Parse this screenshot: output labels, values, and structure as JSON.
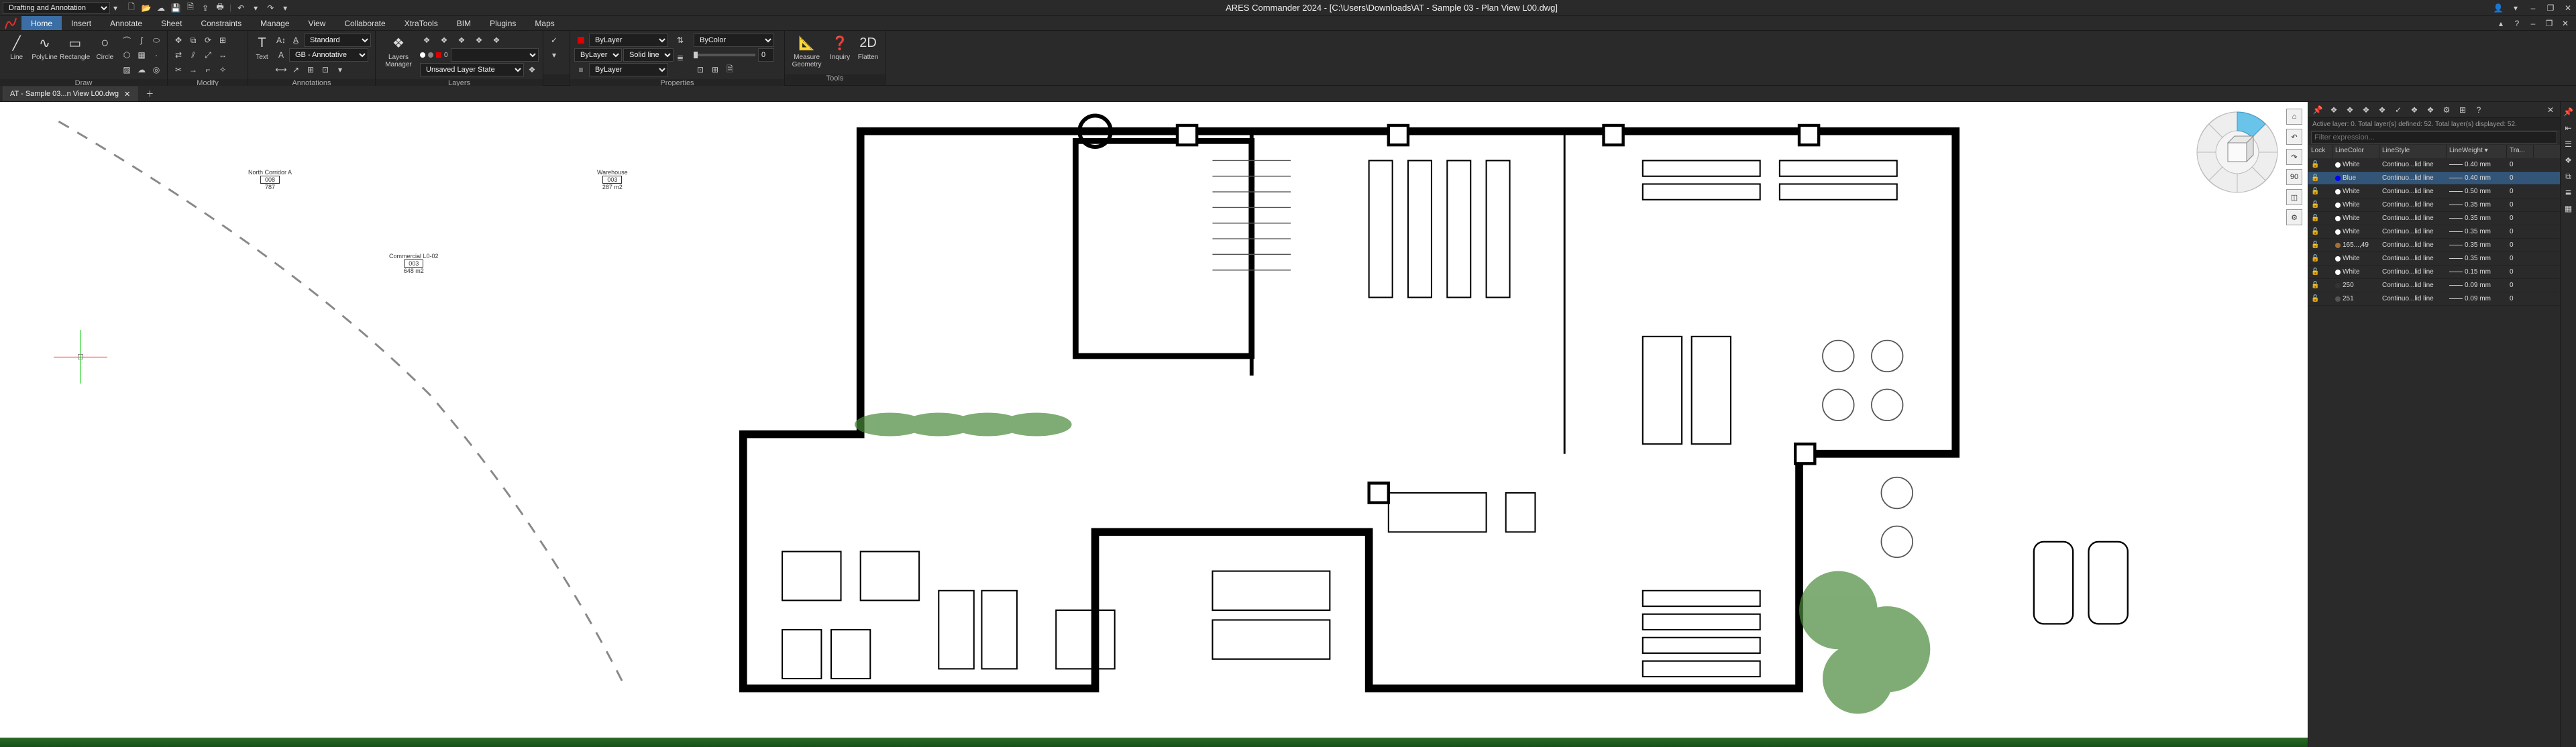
{
  "titlebar": {
    "workspace": "Drafting and Annotation",
    "app_title": "ARES Commander 2024 - [C:\\Users\\Downloads\\AT - Sample 03 - Plan View L00.dwg]"
  },
  "menu": {
    "tabs": [
      "Home",
      "Insert",
      "Annotate",
      "Sheet",
      "Constraints",
      "Manage",
      "View",
      "Collaborate",
      "XtraTools",
      "BIM",
      "Plugins",
      "Maps"
    ],
    "active": "Home"
  },
  "ribbon": {
    "draw": {
      "label": "Draw",
      "tools": [
        "Line",
        "PolyLine",
        "Rectangle",
        "Circle"
      ]
    },
    "modify": {
      "label": "Modify"
    },
    "annotations": {
      "label": "Annotations",
      "text_label": "Text",
      "style_combo": "Standard",
      "dim_combo": "GB - Annotative"
    },
    "layers": {
      "label": "Layers",
      "manager_label": "Layers Manager",
      "state_combo": "Unsaved Layer State"
    },
    "properties": {
      "label": "Properties",
      "color_combo": "ByLayer",
      "linetype1": "ByLayer",
      "linetype2": "Solid line",
      "linetype3": "ByLayer",
      "bycolor": "ByColor",
      "transparency": "0"
    },
    "tools": {
      "label": "Tools",
      "measure_label": "Measure Geometry",
      "inquiry_label": "Inquiry",
      "flatten_label": "Flatten"
    }
  },
  "doctab": {
    "name": "AT - Sample 03...n View L00.dwg"
  },
  "nav": {
    "angle": "90"
  },
  "drawing_labels": {
    "corridor": {
      "title": "North Corridor A",
      "num": "008",
      "area": "787"
    },
    "warehouse": {
      "title": "Warehouse",
      "num": "003",
      "area": "287 m2"
    },
    "commercial": {
      "title": "Commercial L0-02",
      "num": "003",
      "area": "648 m2"
    }
  },
  "layer_panel": {
    "status": "Active layer: 0. Total layer(s) defined: 52. Total layer(s) displayed: 52.",
    "filter_placeholder": "Filter expression...",
    "headers": {
      "lock": "Lock",
      "color": "LineColor",
      "style": "LineStyle",
      "weight": "LineWeight",
      "tra": "Tra..."
    },
    "rows": [
      {
        "color": "White",
        "hex": "#ffffff",
        "style": "Continuo...lid line",
        "weight": "0.40 mm",
        "tra": "0",
        "selected": false
      },
      {
        "color": "Blue",
        "hex": "#0000ff",
        "style": "Continuo...lid line",
        "weight": "0.40 mm",
        "tra": "0",
        "selected": true
      },
      {
        "color": "White",
        "hex": "#ffffff",
        "style": "Continuo...lid line",
        "weight": "0.50 mm",
        "tra": "0",
        "selected": false
      },
      {
        "color": "White",
        "hex": "#ffffff",
        "style": "Continuo...lid line",
        "weight": "0.35 mm",
        "tra": "0",
        "selected": false
      },
      {
        "color": "White",
        "hex": "#ffffff",
        "style": "Continuo...lid line",
        "weight": "0.35 mm",
        "tra": "0",
        "selected": false
      },
      {
        "color": "White",
        "hex": "#ffffff",
        "style": "Continuo...lid line",
        "weight": "0.35 mm",
        "tra": "0",
        "selected": false
      },
      {
        "color": "165...,49",
        "hex": "#a57031",
        "style": "Continuo...lid line",
        "weight": "0.35 mm",
        "tra": "0",
        "selected": false
      },
      {
        "color": "White",
        "hex": "#ffffff",
        "style": "Continuo...lid line",
        "weight": "0.35 mm",
        "tra": "0",
        "selected": false
      },
      {
        "color": "White",
        "hex": "#ffffff",
        "style": "Continuo...lid line",
        "weight": "0.15 mm",
        "tra": "0",
        "selected": false
      },
      {
        "color": "250",
        "hex": "#333333",
        "style": "Continuo...lid line",
        "weight": "0.09 mm",
        "tra": "0",
        "selected": false
      },
      {
        "color": "251",
        "hex": "#555555",
        "style": "Continuo...lid line",
        "weight": "0.09 mm",
        "tra": "0",
        "selected": false
      }
    ]
  }
}
